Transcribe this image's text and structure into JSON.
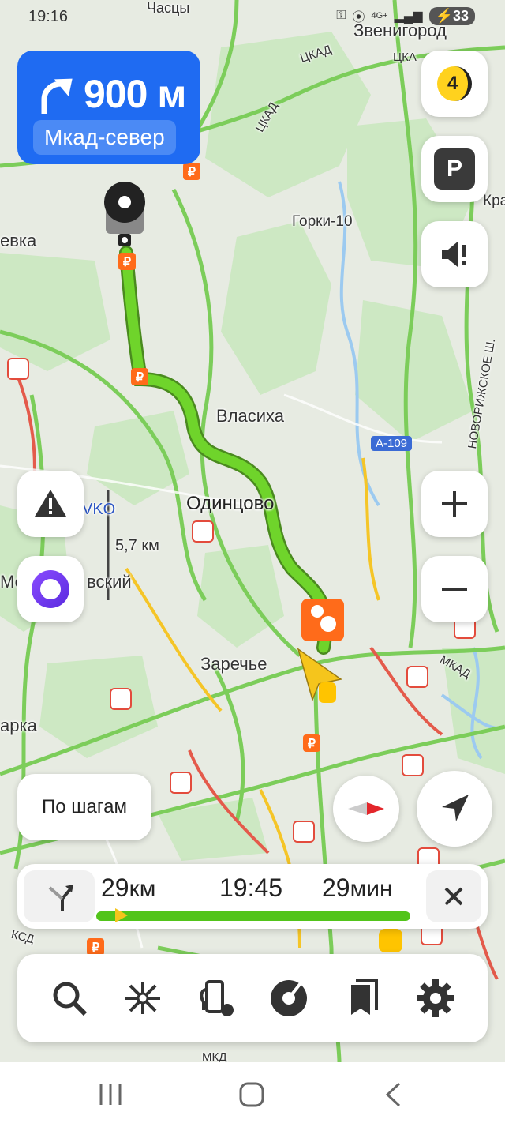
{
  "status_bar": {
    "time": "19:16",
    "network": "4G+",
    "battery": "33"
  },
  "maneuver": {
    "distance": "900 м",
    "street": "Мкад-север"
  },
  "map_labels": {
    "chastsy": "Часцы",
    "zvenigorod": "Звенигород",
    "tskad1": "ЦКАД",
    "tskad2": "ЦКАД",
    "tskad3": "ЦКА",
    "gorki": "Горки-10",
    "evka": "евка",
    "kra": "Кра",
    "novorizhskoe": "НОВОРИЖСКОЕ Ш.",
    "vlasikha": "Власиха",
    "a109": "А-109",
    "odintsovo": "Одинцово",
    "vko": "VKO",
    "scale": "5,7 км",
    "mo": "Мо",
    "vskiy": "вский",
    "zarechye": "Заречье",
    "mkad": "МКАД",
    "arka": "арка",
    "ksd": "КСД",
    "mkd": "МКД"
  },
  "controls": {
    "traffic_level": "4",
    "parking": "P",
    "steps_button": "По шагам"
  },
  "route_info": {
    "distance_value": "29",
    "distance_unit": "км",
    "eta": "19:45",
    "duration_value": "29",
    "duration_unit": "мин",
    "progress": 0.08
  },
  "colors": {
    "maneuver_bg": "#1f6bf2",
    "route": "#52c41a",
    "yellow": "#ffd21e",
    "orange": "#ff6b1a"
  }
}
